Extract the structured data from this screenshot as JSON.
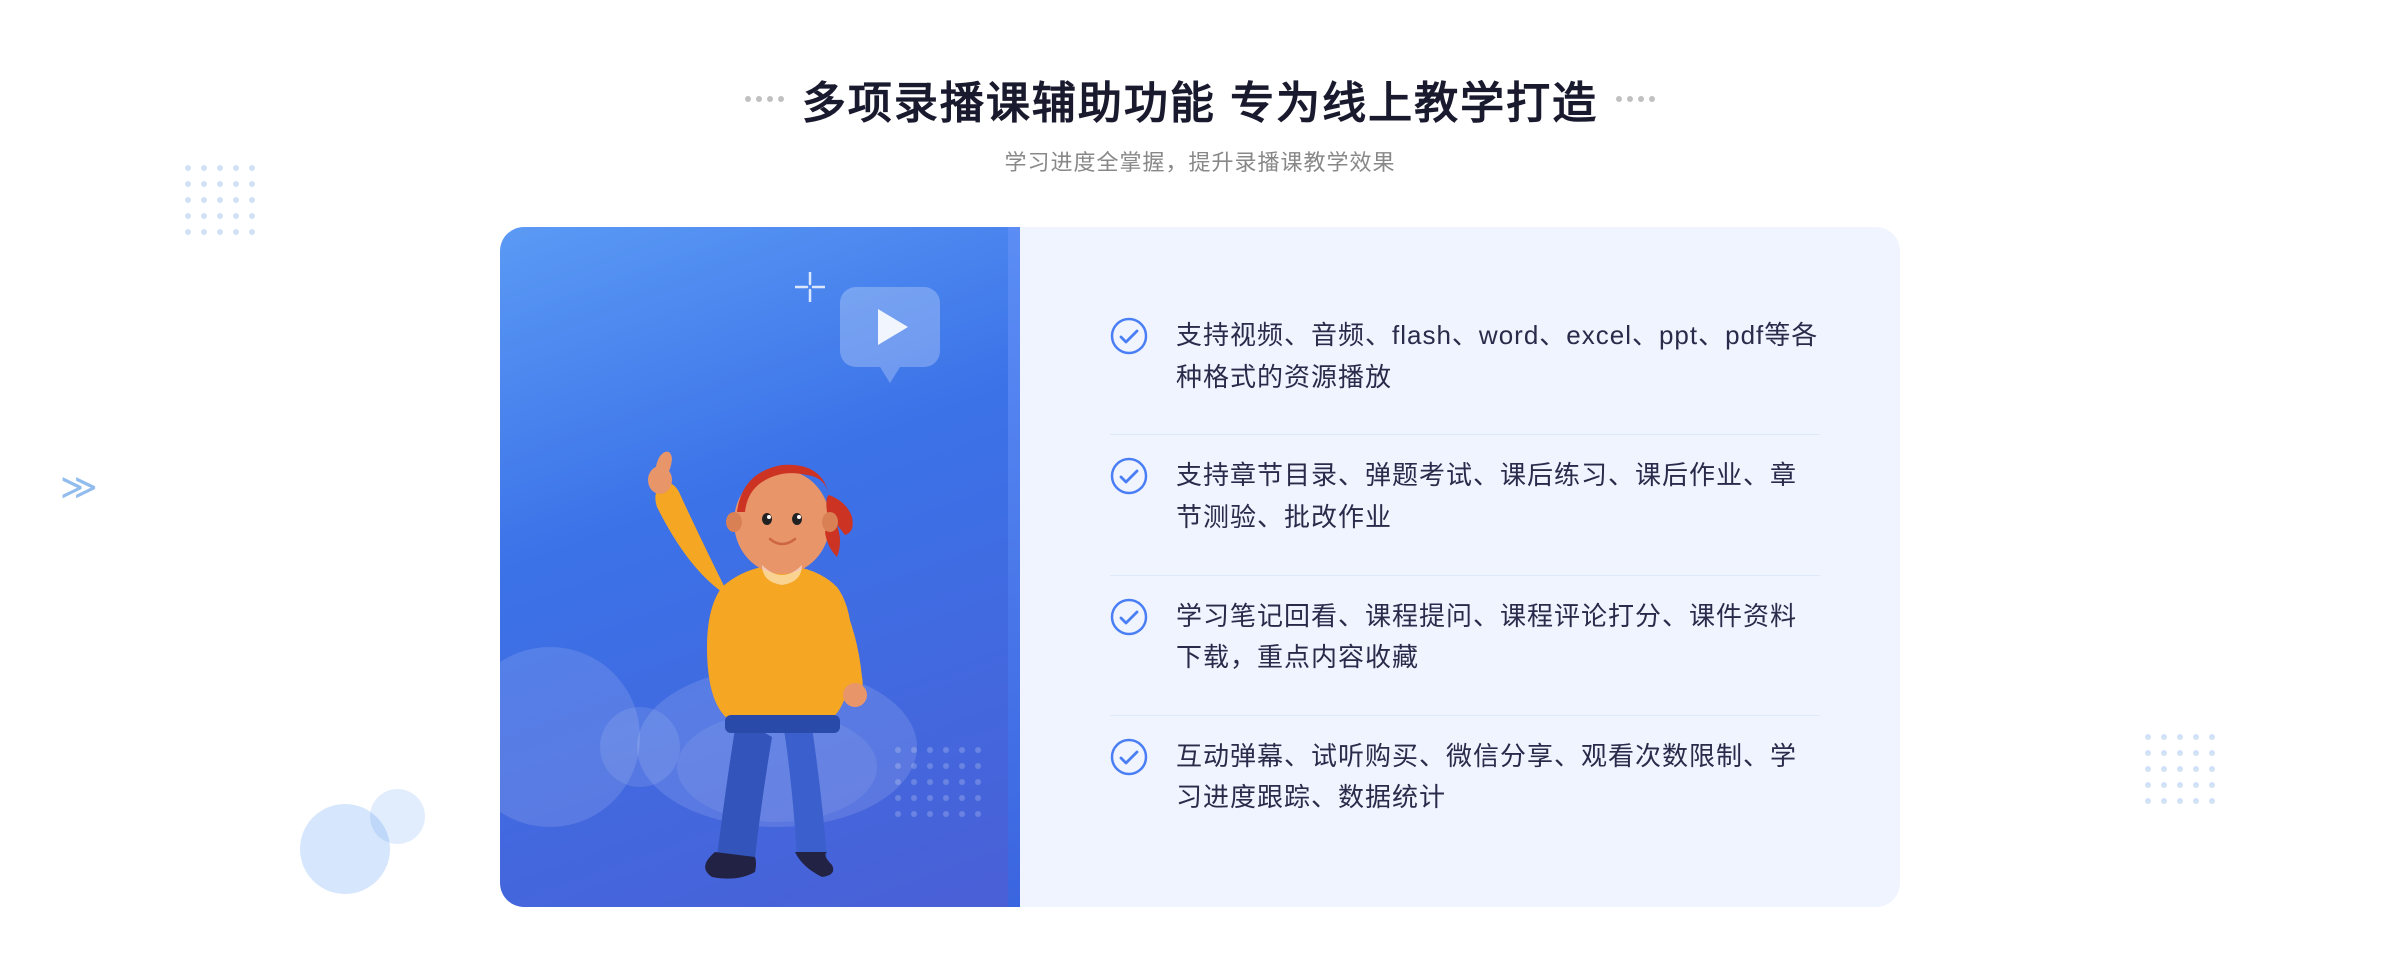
{
  "header": {
    "title": "多项录播课辅助功能 专为线上教学打造",
    "subtitle": "学习进度全掌握，提升录播课教学效果",
    "decoration_dots_label": "decoration dots"
  },
  "features": [
    {
      "id": 1,
      "text": "支持视频、音频、flash、word、excel、ppt、pdf等各种格式的资源播放"
    },
    {
      "id": 2,
      "text": "支持章节目录、弹题考试、课后练习、课后作业、章节测验、批改作业"
    },
    {
      "id": 3,
      "text": "学习笔记回看、课程提问、课程评论打分、课件资料下载，重点内容收藏"
    },
    {
      "id": 4,
      "text": "互动弹幕、试听购买、微信分享、观看次数限制、学习进度跟踪、数据统计"
    }
  ],
  "colors": {
    "primary_blue": "#3b72e8",
    "light_blue": "#5b9af5",
    "bg_feature": "#f0f4ff",
    "text_main": "#2a2a4a",
    "text_sub": "#888888",
    "check_color": "#4a7ef5"
  }
}
